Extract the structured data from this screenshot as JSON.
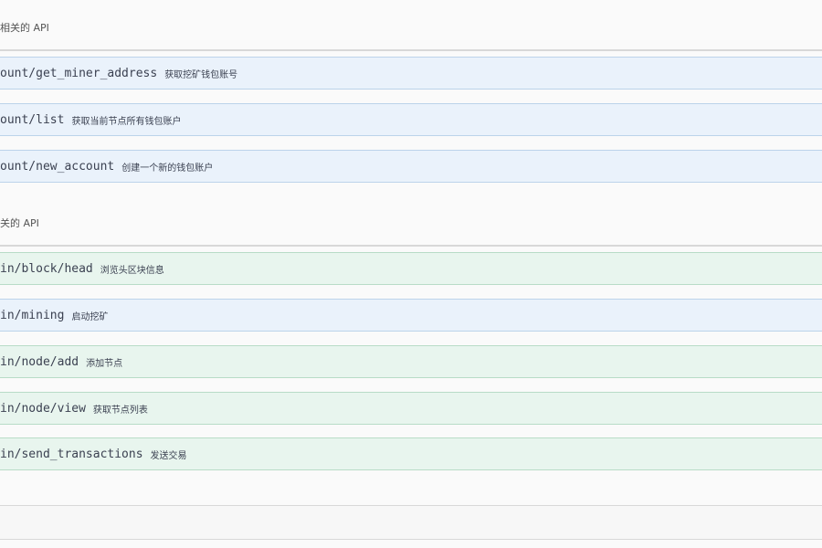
{
  "sections": [
    {
      "title": "相关的 API",
      "operations": [
        {
          "path": "ount/get_miner_address",
          "summary": "获取挖矿钱包账号",
          "color": "#eaf2fb"
        },
        {
          "path": "ount/list",
          "summary": "获取当前节点所有钱包账户",
          "color": "#eaf2fb"
        },
        {
          "path": "ount/new_account",
          "summary": "创建一个新的钱包账户",
          "color": "#eaf2fb"
        }
      ]
    },
    {
      "title": "关的 API",
      "operations": [
        {
          "path": "in/block/head",
          "summary": "浏览头区块信息",
          "color": "#e8f5ee"
        },
        {
          "path": "in/mining",
          "summary": "启动挖矿",
          "color": "#eaf2fb"
        },
        {
          "path": "in/node/add",
          "summary": "添加节点",
          "color": "#e8f5ee"
        },
        {
          "path": "in/node/view",
          "summary": "获取节点列表",
          "color": "#e8f5ee"
        },
        {
          "path": "in/send_transactions",
          "summary": "发送交易",
          "color": "#e8f5ee"
        }
      ]
    }
  ]
}
